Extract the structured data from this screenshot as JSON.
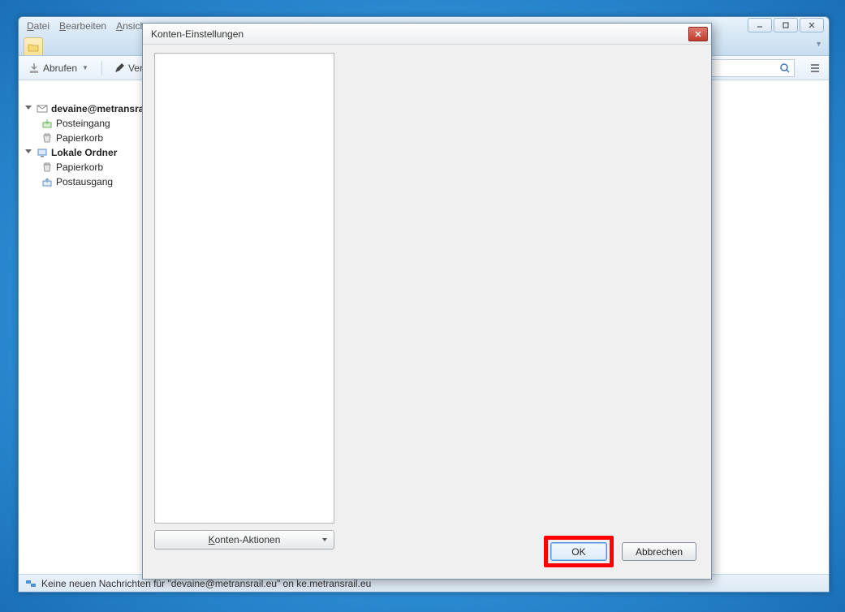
{
  "menubar": {
    "file": "Datei",
    "edit": "Bearbeiten",
    "view": "Ansicht"
  },
  "toolbar": {
    "get": "Abrufen",
    "compose": "Verfa"
  },
  "tree": {
    "account": "devaine@metransra",
    "inbox": "Posteingang",
    "trash1": "Papierkorb",
    "local": "Lokale Ordner",
    "trash2": "Papierkorb",
    "outbox": "Postausgang"
  },
  "status": {
    "text": "Keine neuen Nachrichten für \"devaine@metransrail.eu\" on ke.metransrail.eu"
  },
  "dialog": {
    "title": "Konten-Einstellungen",
    "actions": "Konten-Aktionen",
    "ok": "OK",
    "cancel": "Abbrechen"
  }
}
